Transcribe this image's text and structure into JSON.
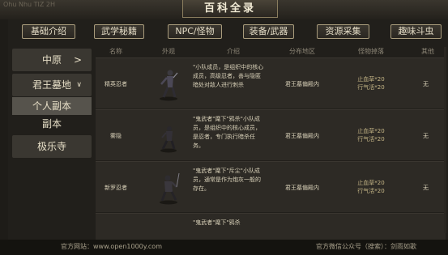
{
  "header": {
    "title": "百科全录",
    "crumb": "Ohu Nhu TIZ 2H"
  },
  "tabs": [
    "基础介绍",
    "武学秘籍",
    "NPC/怪物",
    "装备/武器",
    "资源采集",
    "趣味斗虫"
  ],
  "sidebar": {
    "items": [
      {
        "label": "中原",
        "arrow": ">"
      },
      {
        "label": "君王墓地",
        "arrow": "∨"
      },
      {
        "label": "个人副本"
      },
      {
        "label": "副本"
      },
      {
        "label": "极乐寺"
      }
    ]
  },
  "table": {
    "headers": [
      "名称",
      "外观",
      "介绍",
      "分布地区",
      "怪物掉落",
      "其他"
    ],
    "rows": [
      {
        "name": "精英忍者",
        "intro": "\"小队成员，是组织中的核心成员，高级忍者，善与隐匿暗处对敌人进行刺杀",
        "area": "君王墓偏殿内",
        "drop1": "止血草*20",
        "drop2": "行气活*20",
        "other": "无"
      },
      {
        "name": "雾隐",
        "intro": "\"鬼武者\"麾下\"鸦杀\"小队成员，是组织中的核心成员，是忍者，专门执行暗杀任务。",
        "area": "君王墓偏殿内",
        "drop1": "止血草*20",
        "drop2": "行气活*20",
        "other": "无"
      },
      {
        "name": "新罗忍者",
        "intro": "\"鬼武者\"麾下\"斥尘\"小队成员，通常是作为炮灰一般的存在。",
        "area": "君王墓偏殿内",
        "drop1": "止血草*20",
        "drop2": "行气活*20",
        "other": "无"
      },
      {
        "intro": "\"鬼武者\"麾下\"鸦杀"
      }
    ]
  },
  "footer": {
    "left": "官方网站：www.open1000y.com",
    "right": "官方微信公众号（搜索）：剑雨如歌"
  }
}
